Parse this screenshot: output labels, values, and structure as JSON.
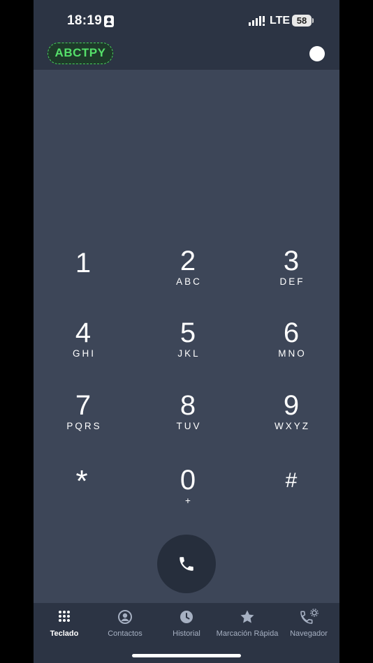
{
  "status_bar": {
    "time": "18:19",
    "network": "LTE",
    "battery": "58"
  },
  "header": {
    "account_label": "ABCTPY",
    "status_dot_color": "#ffffff"
  },
  "keypad": {
    "keys": [
      {
        "digit": "1",
        "letters": ""
      },
      {
        "digit": "2",
        "letters": "ABC"
      },
      {
        "digit": "3",
        "letters": "DEF"
      },
      {
        "digit": "4",
        "letters": "GHI"
      },
      {
        "digit": "5",
        "letters": "JKL"
      },
      {
        "digit": "6",
        "letters": "MNO"
      },
      {
        "digit": "7",
        "letters": "PQRS"
      },
      {
        "digit": "8",
        "letters": "TUV"
      },
      {
        "digit": "9",
        "letters": "WXYZ"
      },
      {
        "digit": "*",
        "letters": ""
      },
      {
        "digit": "0",
        "letters": "+"
      },
      {
        "digit": "#",
        "letters": ""
      }
    ]
  },
  "call_button": {
    "icon": "phone-icon"
  },
  "tabs": [
    {
      "label": "Teclado",
      "icon": "keypad-grid-icon",
      "active": true
    },
    {
      "label": "Contactos",
      "icon": "person-circle-icon",
      "active": false
    },
    {
      "label": "Historial",
      "icon": "clock-icon",
      "active": false
    },
    {
      "label": "Marcación Rápida",
      "icon": "star-icon",
      "active": false
    },
    {
      "label": "Navegador",
      "icon": "phone-gear-icon",
      "active": false
    }
  ],
  "colors": {
    "background": "#3d4658",
    "bars": "#2c3444",
    "accent_green": "#55e06a",
    "call_button": "#262e3c"
  }
}
